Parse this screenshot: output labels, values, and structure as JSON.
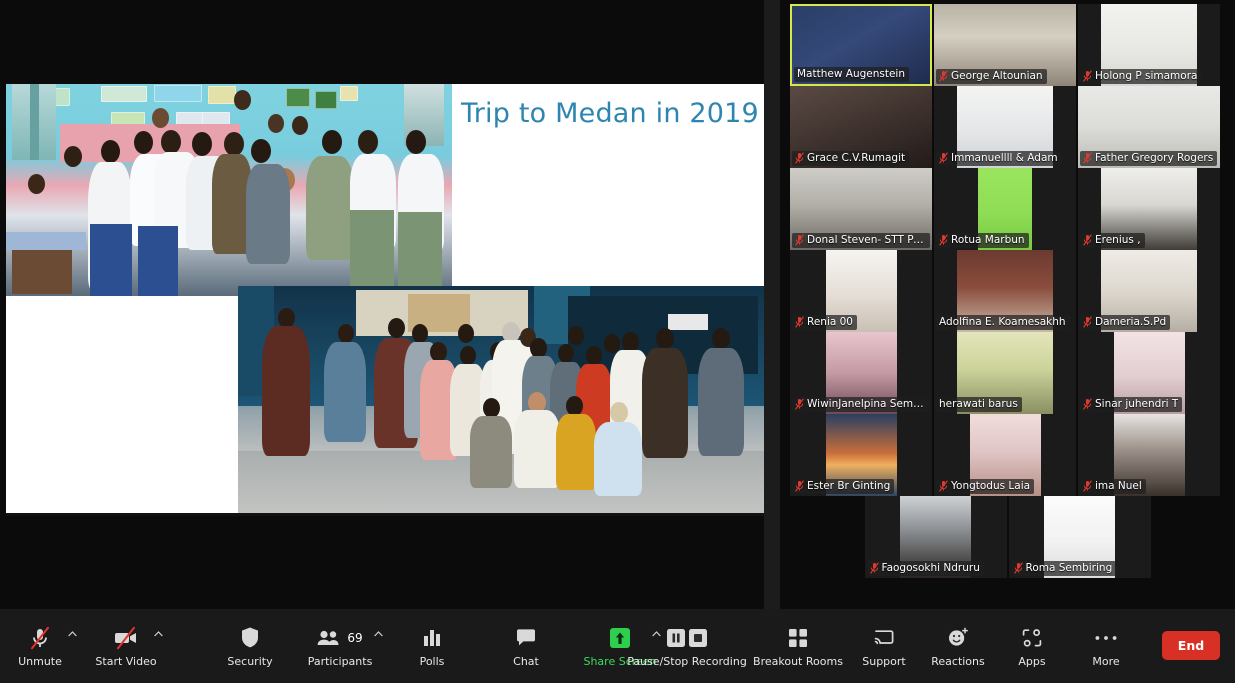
{
  "share": {
    "slide_title": "Trip to Medan in 2019",
    "title_color": "#2e86b0",
    "photo_1_alt": "classroom-group-photo",
    "photo_2_alt": "outdoor-group-photo"
  },
  "gallery": {
    "rows": [
      [
        {
          "name": "Matthew Augenstein",
          "muted": false,
          "active": true,
          "fit": "full",
          "bg": "matthew"
        },
        {
          "name": "George Altounian",
          "muted": true,
          "active": false,
          "fit": "full",
          "bg": "george"
        },
        {
          "name": "Holong P simamora",
          "muted": true,
          "active": false,
          "fit": "narrow2",
          "bg": "holong"
        }
      ],
      [
        {
          "name": "Grace C.V.Rumagit",
          "muted": true,
          "active": false,
          "fit": "full",
          "bg": "grace"
        },
        {
          "name": "Immanuellll & Adam",
          "muted": true,
          "active": false,
          "fit": "narrow2",
          "bg": "immanuel"
        },
        {
          "name": "Father Gregory Rogers",
          "muted": true,
          "active": false,
          "fit": "full",
          "bg": "gregory"
        }
      ],
      [
        {
          "name": "Donal Steven- STT Pa...",
          "muted": true,
          "active": false,
          "fit": "full",
          "bg": "donal"
        },
        {
          "name": "Rotua Marbun",
          "muted": true,
          "active": false,
          "fit": "pillar",
          "bg": "rotua"
        },
        {
          "name": "Erenius ,",
          "muted": true,
          "active": false,
          "fit": "narrow2",
          "bg": "erenius"
        }
      ],
      [
        {
          "name": "Renia 00",
          "muted": true,
          "active": false,
          "fit": "narrow",
          "bg": "renia"
        },
        {
          "name": "Adolfina E. Koamesakhh",
          "muted": false,
          "active": false,
          "fit": "narrow2",
          "bg": "adolfina"
        },
        {
          "name": "Dameria.S.Pd",
          "muted": true,
          "active": false,
          "fit": "narrow2",
          "bg": "dameria"
        }
      ],
      [
        {
          "name": "WiwinJanelpina Semb...",
          "muted": true,
          "active": false,
          "fit": "narrow",
          "bg": "wiwin"
        },
        {
          "name": "herawati barus",
          "muted": false,
          "active": false,
          "fit": "narrow2",
          "bg": "herawati"
        },
        {
          "name": "Sinar juhendri T",
          "muted": true,
          "active": false,
          "fit": "narrow",
          "bg": "sinar"
        }
      ],
      [
        {
          "name": "Ester  Br Ginting",
          "muted": true,
          "active": false,
          "fit": "narrow",
          "bg": "ester"
        },
        {
          "name": "Yongtodus Laia",
          "muted": true,
          "active": false,
          "fit": "narrow",
          "bg": "yongtodus"
        },
        {
          "name": "ima Nuel",
          "muted": true,
          "active": false,
          "fit": "narrow",
          "bg": "imanuel"
        }
      ],
      [
        {
          "name": "Faogosokhi Ndruru",
          "muted": true,
          "active": false,
          "fit": "narrow",
          "bg": "faogosokhi"
        },
        {
          "name": "Roma Sembiring",
          "muted": true,
          "active": false,
          "fit": "narrow",
          "bg": "roma"
        }
      ]
    ],
    "active_speaker_border_color": "#d7e84b"
  },
  "toolbar": {
    "audio": {
      "label": "Unmute",
      "icon": "microphone-muted-icon",
      "has_caret": true
    },
    "video": {
      "label": "Start Video",
      "icon": "camera-muted-icon",
      "has_caret": true
    },
    "security": {
      "label": "Security",
      "icon": "shield-icon",
      "has_caret": false
    },
    "participants": {
      "label": "Participants",
      "icon": "people-icon",
      "has_caret": true,
      "count": "69"
    },
    "polls": {
      "label": "Polls",
      "icon": "bar-chart-icon",
      "has_caret": false
    },
    "chat": {
      "label": "Chat",
      "icon": "speech-bubble-icon",
      "has_caret": false
    },
    "share": {
      "label": "Share Screen",
      "icon": "share-arrow-up-icon",
      "has_caret": true,
      "color": "#3ddc5b"
    },
    "recording": {
      "label": "Pause/Stop Recording",
      "icon": "pause-stop-icon",
      "has_caret": false
    },
    "breakout": {
      "label": "Breakout Rooms",
      "icon": "grid-squares-icon",
      "has_caret": false
    },
    "support": {
      "label": "Support",
      "icon": "support-cast-icon",
      "has_caret": false
    },
    "reactions": {
      "label": "Reactions",
      "icon": "smiley-plus-icon",
      "has_caret": false
    },
    "apps": {
      "label": "Apps",
      "icon": "apps-brackets-icon",
      "has_caret": false
    },
    "more": {
      "label": "More",
      "icon": "ellipsis-icon",
      "has_caret": false
    },
    "end": {
      "label": "End",
      "color": "#d93025"
    }
  }
}
